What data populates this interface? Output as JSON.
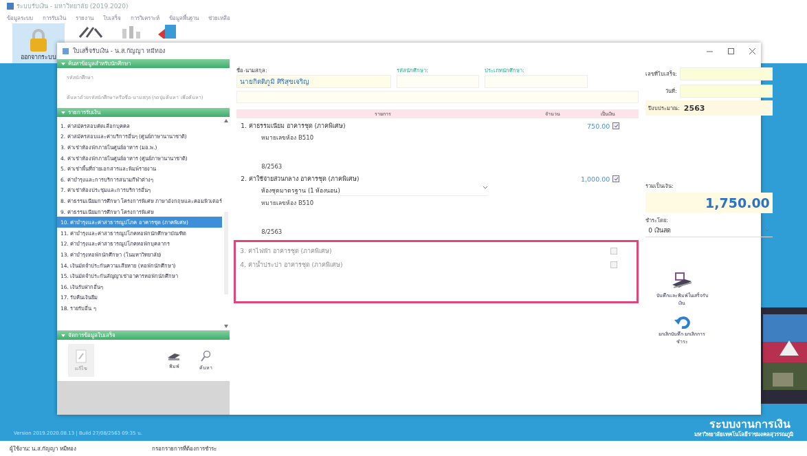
{
  "app": {
    "title": "ระบบรับเงิน - มหาวิทยาลัย (2019.2020)",
    "menu": [
      "ข้อมูลระบบ",
      "การรับเงิน",
      "รายงาน",
      "ใบเสร็จ",
      "การวิเคราะห์",
      "ข้อมูลพื้นฐาน",
      "ช่วยเหลือ"
    ],
    "logout_button": {
      "label": "ออกจากระบบ",
      "selected": true
    }
  },
  "dialog": {
    "title": "ใบเสร็จรับเงิน - น.ส.กัญญา หมีทอง",
    "sections": [
      {
        "title": "ค้นหาข้อมูลสำหรับนักศึกษา",
        "expanded": true
      },
      {
        "title": "รายการรับเงิน",
        "expanded": true
      },
      {
        "title": "จัดการข้อมูลใบเสร็จ",
        "expanded": true
      }
    ],
    "search": {
      "student_id_placeholder": "รหัสนักศึกษา",
      "name_placeholder": "ค้นหาด้วยรหัสนักศึกษาหรือชื่อ-นามสกุล (กดปุ่มค้นหา เพื่อค้นหา)"
    },
    "payment_types": [
      {
        "label": "1. ค่าสมัครสอบคัดเลือกบุคคล",
        "selected": false
      },
      {
        "label": "2. ค่าสมัครสอบและค่าบริการอื่นๆ (ศูนย์ภาษานานาชาติ)",
        "selected": false
      },
      {
        "label": "3. ค่าเช่าห้องพักภายในศูนย์อาหาร (มอ.พ.)",
        "selected": false
      },
      {
        "label": "4. ค่าเช่าห้องพักภายในศูนย์อาหาร (ศูนย์ภาษานานาชาติ)",
        "selected": false
      },
      {
        "label": "5. ค่าเช่าพื้นที่ถ่ายเอกสารและพิมพ์รายงาน",
        "selected": false
      },
      {
        "label": "6. ค่าบำรุงและการบริการสนามกีฬาต่างๆ",
        "selected": false
      },
      {
        "label": "7. ค่าเช่าห้องประชุมและการบริการอื่นๆ",
        "selected": false
      },
      {
        "label": "8. ค่าธรรมเนียมการศึกษา โครงการพิเศษ ภาษาอังกฤษและคอมพิวเตอร์",
        "selected": false
      },
      {
        "label": "9. ค่าธรรมเนียมการศึกษา โครงการพิเศษ",
        "selected": false
      },
      {
        "label": "10. ค่าบำรุงและค่าสาธารณูปโภค อาคารชุด (ภาคพิเศษ)",
        "selected": true
      },
      {
        "label": "11. ค่าบำรุงและค่าสาธารณูปโภคหอพักนักศึกษาบัณฑิต",
        "selected": false
      },
      {
        "label": "12. ค่าบำรุงและค่าสาธารณูปโภคหอพักบุคลากร",
        "selected": false
      },
      {
        "label": "13. ค่าบำรุงหอพักนักศึกษา (ในมหาวิทยาลัย)",
        "selected": false
      },
      {
        "label": "14. เงินมัดจำประกันความเสียหาย (หอพักนักศึกษา)",
        "selected": false
      },
      {
        "label": "15. เงินมัดจำประกันสัญญาเช่าอาคารหอพักนักศึกษา",
        "selected": false
      },
      {
        "label": "16. เงินรับฝากอื่นๆ",
        "selected": false
      },
      {
        "label": "17. รับคืนเงินยืม",
        "selected": false
      },
      {
        "label": "18. รายรับอื่น ๆ",
        "selected": false
      }
    ],
    "tools": [
      {
        "kind": "edit",
        "label": "แก้ไข",
        "disabled": true
      },
      {
        "kind": "print",
        "label": "พิมพ์",
        "disabled": false
      },
      {
        "kind": "search",
        "label": "ค้นหา",
        "disabled": false
      }
    ],
    "form": {
      "name_label": "ชื่อ-นามสกุล:",
      "name_value": "นายกิตติภูมิ ศิริสุขเจริญ",
      "student_id_label": "รหัสนักศึกษา:",
      "student_type_label": "ประเภทนักศึกษา:",
      "receipt_no_label": "เลขที่ใบเสร็จ:",
      "date_label": "วันที่:",
      "fiscal_year_label": "ปีงบประมาณ:",
      "fiscal_year_value": "2563"
    },
    "columns": [
      "รายการ",
      "จำนวน",
      "เป็นเงิน"
    ],
    "items": [
      {
        "title": "1. ค่าธรรมเนียม อาคารชุด (ภาคพิเศษ)",
        "lines": [
          "หมายเลขห้อง B510"
        ],
        "period": "8/2563",
        "amount": "750.00",
        "checked": true,
        "disabled": false
      },
      {
        "title": "2. ค่าใช้จ่ายส่วนกลาง อาคารชุด (ภาคพิเศษ)",
        "option": "ห้องชุดมาตรฐาน (1 ห้องนอน)",
        "lines": [
          "หมายเลขห้อง B510"
        ],
        "period": "8/2563",
        "amount": "1,000.00",
        "checked": true,
        "disabled": false
      },
      {
        "title": "3. ค่าไฟฟ้า อาคารชุด (ภาคพิเศษ)",
        "checked": false,
        "disabled": true
      },
      {
        "title": "4. ค่าน้ำประปา อาคารชุด (ภาคพิเศษ)",
        "checked": false,
        "disabled": true
      }
    ],
    "total_label": "รวมเป็นเงิน:",
    "total_value": "1,750.00",
    "pay_by_label": "ชำระโดย:",
    "pay_by_value": "0 เงินสด",
    "actions": [
      {
        "kind": "save",
        "label": "บันทึกและพิมพ์ใบเสร็จรับเงิน"
      },
      {
        "kind": "undo",
        "label": "ยกเลิกบันทึก ยกเลิกการชำระ"
      }
    ]
  },
  "logo": {
    "title": "ระบบงานการเงิน",
    "subtitle": "มหาวิทยาลัยเทคโนโลยีราชมงคลสุวรรณภูมิ"
  },
  "footer": {
    "version": "Version 2019.2020.08.13 | Build 27/08/2563 09:35 น.",
    "user": "ผู้ใช้งาน: น.ส.กัญญา หมีทอง",
    "hint": "กรอกรายการที่ต้องการชำระ"
  }
}
